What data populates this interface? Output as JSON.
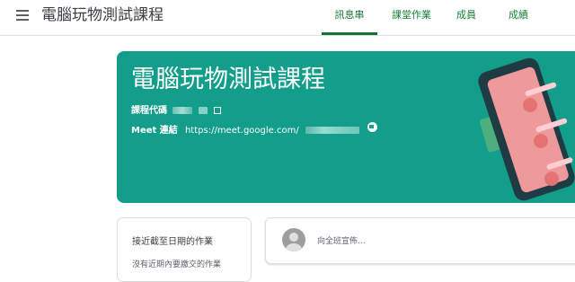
{
  "app": {
    "title": "電腦玩物測試課程"
  },
  "tabs": [
    {
      "label": "訊息串",
      "active": true
    },
    {
      "label": "課堂作業",
      "active": false
    },
    {
      "label": "成員",
      "active": false
    },
    {
      "label": "成績",
      "active": false
    }
  ],
  "banner": {
    "title": "電腦玩物測試課程",
    "class_code_label": "課程代碼",
    "meet_label": "Meet 連結",
    "meet_url": "https://meet.google.com/",
    "color": "#129e8a"
  },
  "upcoming": {
    "title": "接近截至日期的作業",
    "empty_text": "沒有近期內要繳交的作業"
  },
  "announce": {
    "placeholder": "向全班宣佈..."
  },
  "icons": {
    "menu": "menu-icon",
    "fullscreen": "fullscreen-icon",
    "video": "video-icon",
    "avatar": "avatar"
  },
  "colors": {
    "accent": "#137333",
    "banner": "#129e8a"
  }
}
